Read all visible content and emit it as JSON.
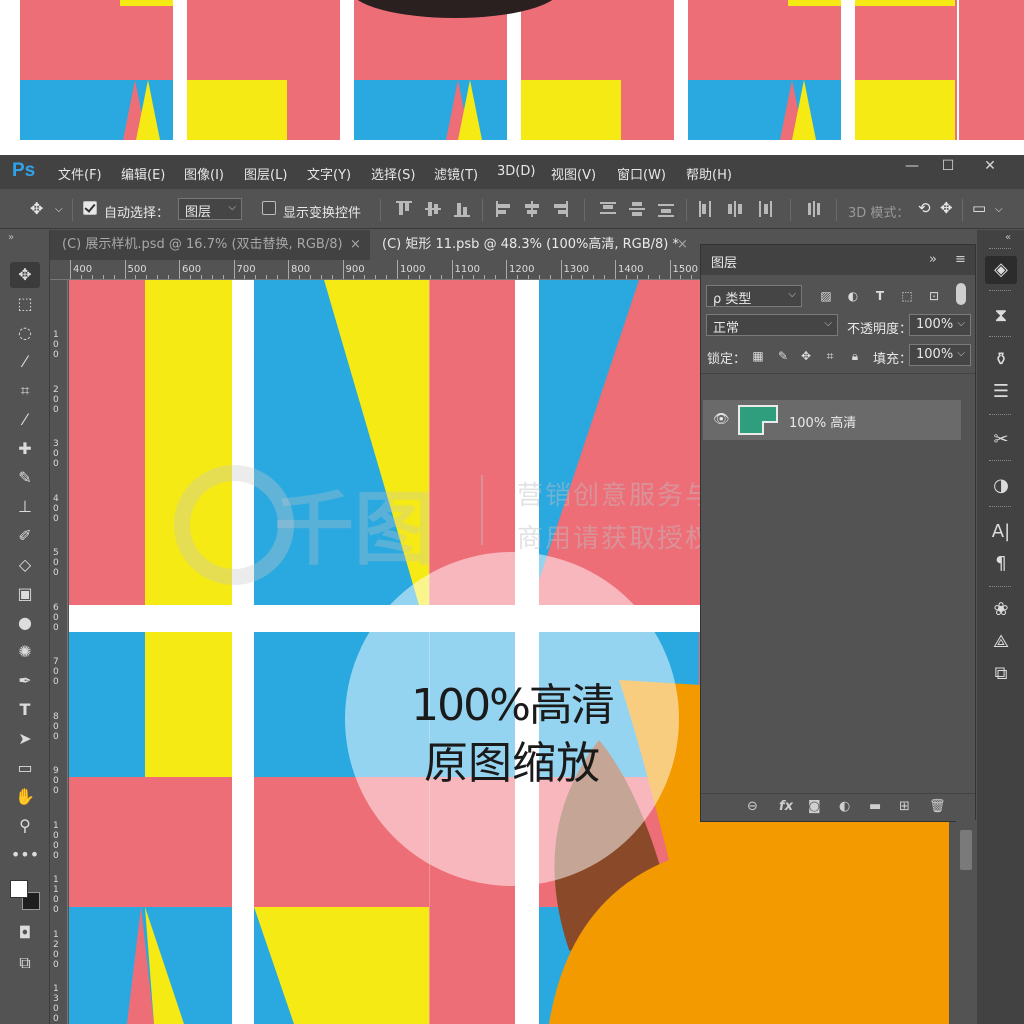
{
  "preview": {
    "colors": {
      "pink": "#ee6e78",
      "yellow": "#f5ea14",
      "blue": "#2aa8e0",
      "dark": "#2b2020"
    }
  },
  "app": {
    "logo": "Ps",
    "menu": [
      "文件(F)",
      "编辑(E)",
      "图像(I)",
      "图层(L)",
      "文字(Y)",
      "选择(S)",
      "滤镜(T)",
      "3D(D)",
      "视图(V)",
      "窗口(W)",
      "帮助(H)"
    ],
    "window_controls": {
      "minimize": "—",
      "maximize": "☐",
      "close": "✕"
    }
  },
  "options": {
    "move_icon": "move-icon",
    "auto_select_label": "自动选择：",
    "auto_select_checked": true,
    "auto_select_target": "图层",
    "show_transform_label": "显示变换控件",
    "show_transform_checked": false,
    "mode_3d_label": "3D 模式："
  },
  "tabs": [
    {
      "label": "(C) 展示样机.psd @ 16.7% (双击替换, RGB/8)",
      "close": "×",
      "active": false
    },
    {
      "label": "(C) 矩形 11.psb @ 48.3% (100%高清, RGB/8) *",
      "close": "×",
      "active": true
    }
  ],
  "ruler": {
    "top_labels": [
      "400",
      "500",
      "600",
      "700",
      "800",
      "900",
      "1000",
      "1100",
      "1200",
      "1300",
      "1400",
      "1500"
    ],
    "left_labels": [
      "1\n0\n0",
      "2\n0\n0",
      "3\n0\n0",
      "4\n0\n0",
      "5\n0\n0",
      "6\n0\n0",
      "7\n0\n0",
      "8\n0\n0",
      "9\n0\n0",
      "1\n0\n0\n0",
      "1\n1\n0\n0",
      "1\n2\n0\n0",
      "1\n3\n0\n0"
    ]
  },
  "canvas": {
    "watermark_line1": "营销创意服务与协作平台",
    "watermark_line2": "商用请获取授权",
    "watermark_logo": "千图",
    "zoom_line1": "100%高清",
    "zoom_line2": "原图缩放",
    "colors": {
      "pink": "#ee6e78",
      "yellow": "#f5ea14",
      "blue": "#2aa8e0",
      "orange": "#f39a00",
      "brown": "#8a4a2a"
    }
  },
  "layers_panel": {
    "title": "图层",
    "filter_label": "ρ 类型",
    "blend_mode": "正常",
    "opacity_label": "不透明度：",
    "opacity_value": "100%",
    "lock_label": "锁定：",
    "fill_label": "填充：",
    "fill_value": "100%",
    "layer_name": "100% 高清",
    "layer_thumb_color": "#2f9e7c"
  },
  "tools": [
    "move-tool",
    "marquee-tool",
    "lasso-tool",
    "magic-wand-tool",
    "crop-tool",
    "eyedropper-tool",
    "healing-tool",
    "brush-tool",
    "stamp-tool",
    "history-brush-tool",
    "eraser-tool",
    "gradient-tool",
    "blur-tool",
    "dodge-tool",
    "pen-tool",
    "type-tool",
    "path-select-tool",
    "rectangle-tool",
    "hand-tool",
    "zoom-tool",
    "more-tools"
  ]
}
